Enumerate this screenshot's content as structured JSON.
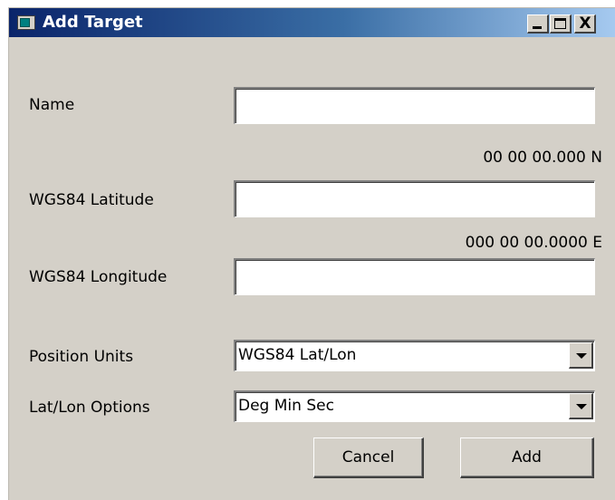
{
  "window": {
    "title": "Add Target",
    "titlebar_gradient": [
      "#0a246a",
      "#a6caf0"
    ],
    "face_color": "#d4d0c8",
    "controls": {
      "minimize": "_",
      "maximize": "□",
      "close": "X"
    }
  },
  "form": {
    "name": {
      "label": "Name",
      "value": ""
    },
    "latitude": {
      "format_hint": "00 00 00.000 N",
      "label": "WGS84 Latitude",
      "value": ""
    },
    "longitude": {
      "format_hint": "000 00 00.0000 E",
      "label": "WGS84 Longitude",
      "value": ""
    },
    "position_units": {
      "label": "Position Units",
      "selected": "WGS84 Lat/Lon"
    },
    "latlon_options": {
      "label": "Lat/Lon Options",
      "selected": "Deg Min Sec"
    }
  },
  "buttons": {
    "cancel": "Cancel",
    "add": "Add"
  },
  "icons": {
    "app": "window-app-icon",
    "dropdown": "chevron-down-icon"
  }
}
